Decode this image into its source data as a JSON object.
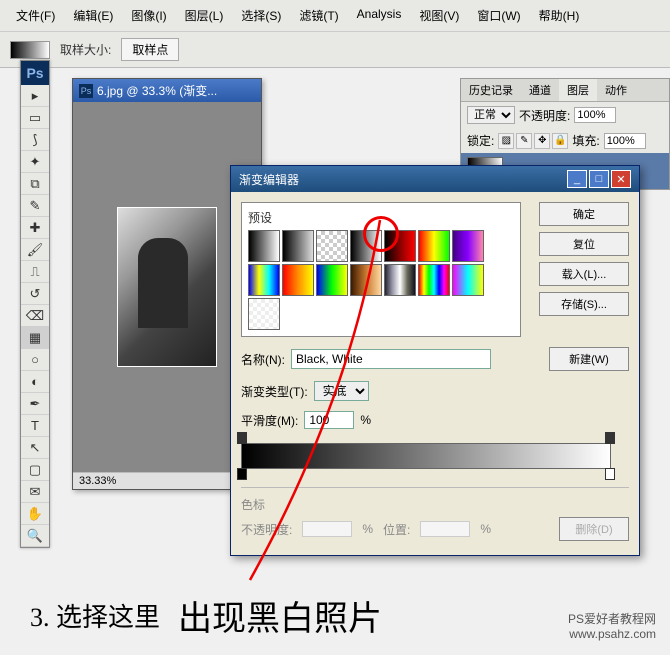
{
  "menubar": [
    "文件(F)",
    "编辑(E)",
    "图像(I)",
    "图层(L)",
    "选择(S)",
    "滤镜(T)",
    "Analysis",
    "视图(V)",
    "窗口(W)",
    "帮助(H)"
  ],
  "optbar": {
    "label": "取样大小:",
    "sample_btn": "取样点"
  },
  "doc": {
    "title": "6.jpg @ 33.3% (渐变...",
    "zoom": "33.33%"
  },
  "rpanel": {
    "tabs": [
      "历史记录",
      "通道",
      "图层",
      "动作"
    ],
    "blend": "正常",
    "opacity_lbl": "不透明度:",
    "opacity": "100%",
    "lock_lbl": "锁定:",
    "fill_lbl": "填充:",
    "fill": "100%"
  },
  "dlg": {
    "title": "渐变编辑器",
    "preset_lbl": "预设",
    "btns": {
      "ok": "确定",
      "reset": "复位",
      "load": "载入(L)...",
      "save": "存储(S)..."
    },
    "name_lbl": "名称(N):",
    "name_val": "Black, White",
    "new_btn": "新建(W)",
    "type_lbl": "渐变类型(T):",
    "type_val": "实底",
    "smooth_lbl": "平滑度(M):",
    "smooth_val": "100",
    "pct": "%",
    "stops_lbl": "色标",
    "op_lbl": "不透明度:",
    "pos_lbl": "位置:",
    "del_btn": "删除(D)"
  },
  "caption": {
    "step": "3. 选择这里",
    "result": "出现黑白照片"
  },
  "site": {
    "name": "PS爱好者教程网",
    "url": "www.psahz.com"
  }
}
